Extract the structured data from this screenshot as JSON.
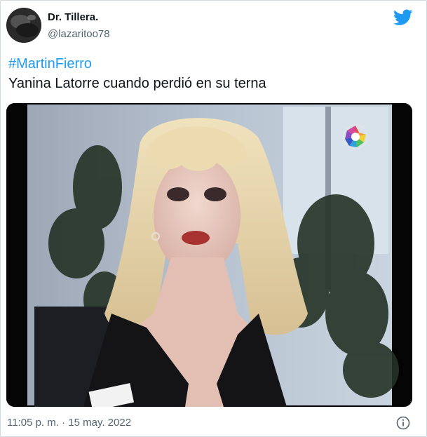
{
  "author": {
    "name": "Dr. Tillera.",
    "handle": "@lazaritoo78"
  },
  "tweet": {
    "hashtag": "#MartinFierro",
    "text": "Yanina Latorre cuando perdió en su terna",
    "timestamp": "11:05 p. m. · 15 may. 2022"
  },
  "media": {
    "description_icon": "tv-channel-logo"
  },
  "colors": {
    "accent": "#1d9bf0",
    "secondary_text": "#536471",
    "border": "#cfd9de"
  },
  "icons": {
    "brand": "twitter-bird-icon",
    "info": "info-icon"
  }
}
